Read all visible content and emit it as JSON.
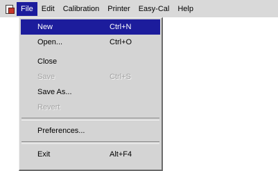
{
  "menubar": {
    "items": [
      {
        "label": "File",
        "active": true
      },
      {
        "label": "Edit"
      },
      {
        "label": "Calibration"
      },
      {
        "label": "Printer"
      },
      {
        "label": "Easy-Cal"
      },
      {
        "label": "Help"
      }
    ]
  },
  "file_menu": {
    "items": [
      {
        "label": "New",
        "shortcut": "Ctrl+N",
        "state": "highlighted"
      },
      {
        "label": "Open...",
        "shortcut": "Ctrl+O",
        "state": "enabled"
      },
      {
        "label": "Close",
        "shortcut": "",
        "state": "enabled"
      },
      {
        "label": "Save",
        "shortcut": "Ctrl+S",
        "state": "disabled"
      },
      {
        "label": "Save As...",
        "shortcut": "",
        "state": "enabled"
      },
      {
        "label": "Revert",
        "shortcut": "",
        "state": "disabled"
      },
      {
        "label": "Preferences...",
        "shortcut": "",
        "state": "enabled"
      },
      {
        "label": "Exit",
        "shortcut": "Alt+F4",
        "state": "enabled"
      }
    ]
  },
  "colors": {
    "menu_background": "#d4d4d4",
    "highlight": "#1c1c9c",
    "disabled_text": "#a3a3a3"
  },
  "icons": {
    "app": "app-document-icon"
  }
}
